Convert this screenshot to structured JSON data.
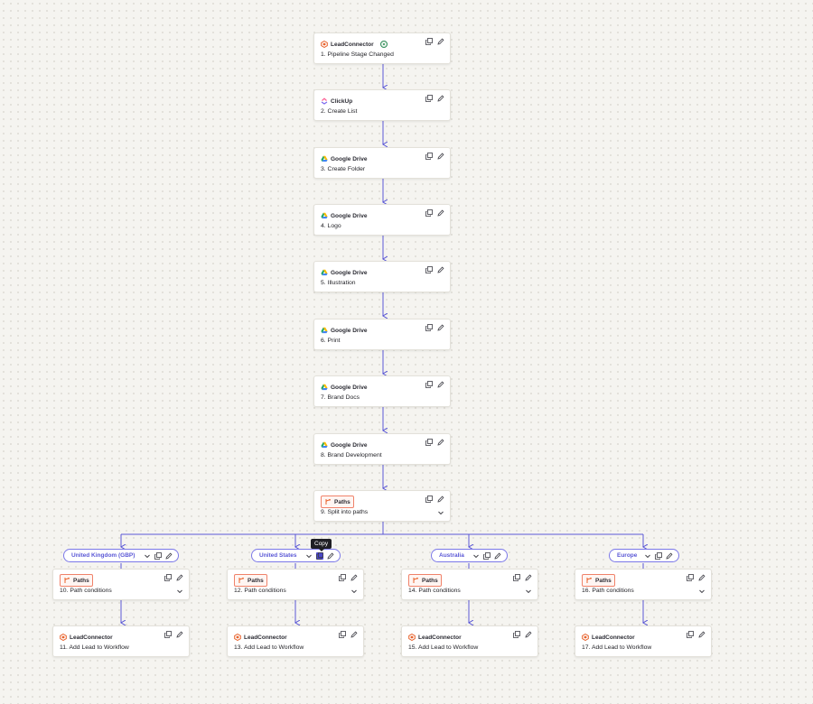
{
  "steps": [
    {
      "app": "LeadConnector",
      "title": "1. Pipeline Stage Changed"
    },
    {
      "app": "ClickUp",
      "title": "2. Create List"
    },
    {
      "app": "Google Drive",
      "title": "3. Create Folder"
    },
    {
      "app": "Google Drive",
      "title": "4. Logo"
    },
    {
      "app": "Google Drive",
      "title": "5. Illustration"
    },
    {
      "app": "Google Drive",
      "title": "6. Print"
    },
    {
      "app": "Google Drive",
      "title": "7. Brand Docs"
    },
    {
      "app": "Google Drive",
      "title": "8. Brand Development"
    },
    {
      "app": "Paths",
      "title": "9. Split into paths"
    }
  ],
  "branches": [
    {
      "name": "United Kingdom (GBP)",
      "paths_app": "Paths",
      "paths_title": "10. Path conditions",
      "action_app": "LeadConnector",
      "action_title": "11. Add Lead to Workflow"
    },
    {
      "name": "United States",
      "paths_app": "Paths",
      "paths_title": "12. Path conditions",
      "action_app": "LeadConnector",
      "action_title": "13. Add Lead to Workflow"
    },
    {
      "name": "Australia",
      "paths_app": "Paths",
      "paths_title": "14. Path conditions",
      "action_app": "LeadConnector",
      "action_title": "15. Add Lead to Workflow"
    },
    {
      "name": "Europe",
      "paths_app": "Paths",
      "paths_title": "16. Path conditions",
      "action_app": "LeadConnector",
      "action_title": "17. Add Lead to Workflow"
    }
  ],
  "tooltip": "Copy",
  "colors": {
    "accent": "#5a57d6",
    "paths": "#f0826a",
    "leadconnector": "#e8622c",
    "success": "#2e8b57"
  },
  "icons": {
    "copy": "copy-icon",
    "edit": "pencil-icon",
    "expand": "chevron-down-icon",
    "paths": "paths-icon"
  }
}
